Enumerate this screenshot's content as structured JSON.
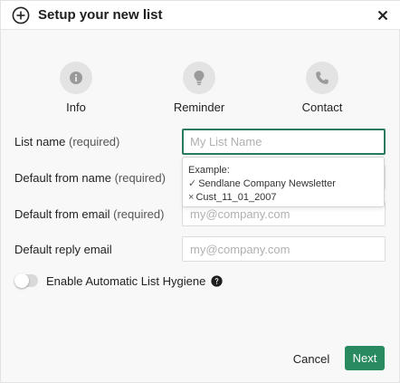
{
  "dialog": {
    "title": "Setup your new list",
    "close_label": "×"
  },
  "steps": [
    {
      "label": "Info",
      "icon": "info-icon"
    },
    {
      "label": "Reminder",
      "icon": "lightbulb-icon"
    },
    {
      "label": "Contact",
      "icon": "phone-icon"
    }
  ],
  "fields": {
    "list_name": {
      "label": "List name",
      "required": "(required)",
      "value": "",
      "placeholder": "My List Name"
    },
    "from_name": {
      "label": "Default from name",
      "required": "(required)"
    },
    "from_email": {
      "label": "Default from email",
      "required": "(required)",
      "value": "",
      "placeholder": "my@company.com"
    },
    "reply_email": {
      "label": "Default reply email",
      "value": "",
      "placeholder": "my@company.com"
    }
  },
  "tooltip": {
    "heading": "Example:",
    "good_mark": "✓",
    "good_example": "Sendlane Company Newsletter",
    "bad_mark": "×",
    "bad_example": "Cust_11_01_2007"
  },
  "hygiene": {
    "label": "Enable Automatic List Hygiene",
    "enabled": false
  },
  "footer": {
    "cancel_label": "Cancel",
    "next_label": "Next"
  },
  "colors": {
    "accent": "#2a8a5f",
    "focus_border": "#2a7a5d",
    "step_circle": "#e3e3e3",
    "step_icon": "#9a9a9a"
  }
}
